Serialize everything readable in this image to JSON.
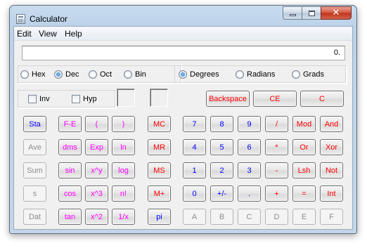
{
  "window": {
    "title": "Calculator"
  },
  "menu": [
    "Edit",
    "View",
    "Help"
  ],
  "display": {
    "value": "0."
  },
  "base": {
    "options": [
      "Hex",
      "Dec",
      "Oct",
      "Bin"
    ],
    "selected": "Dec"
  },
  "angle": {
    "options": [
      "Degrees",
      "Radians",
      "Grads"
    ],
    "selected": "Degrees"
  },
  "checks": {
    "inv": "Inv",
    "hyp": "Hyp"
  },
  "edit_buttons": {
    "backspace": "Backspace",
    "ce": "CE",
    "c": "C"
  },
  "stat_col": [
    "Sta",
    "Ave",
    "Sum",
    "s",
    "Dat"
  ],
  "sci_col1": [
    "F-E",
    "dms",
    "sin",
    "cos",
    "tan"
  ],
  "sci_col2": [
    "(",
    "Exp",
    "x^y",
    "x^3",
    "x^2"
  ],
  "sci_col3": [
    ")",
    "ln",
    "log",
    "n!",
    "1/x"
  ],
  "mem_col": [
    "MC",
    "MR",
    "MS",
    "M+",
    "pi"
  ],
  "keypad": [
    [
      "7",
      "8",
      "9",
      "/",
      "Mod",
      "And"
    ],
    [
      "4",
      "5",
      "6",
      "*",
      "Or",
      "Xor"
    ],
    [
      "1",
      "2",
      "3",
      "-",
      "Lsh",
      "Not"
    ],
    [
      "0",
      "+/-",
      ".",
      "+",
      "=",
      "Int"
    ],
    [
      "A",
      "B",
      "C",
      "D",
      "E",
      "F"
    ]
  ],
  "colors": {
    "blue": "#0000ff",
    "red": "#ff0000",
    "magenta": "#ff00ff",
    "disabled": "#8d8d8d"
  }
}
